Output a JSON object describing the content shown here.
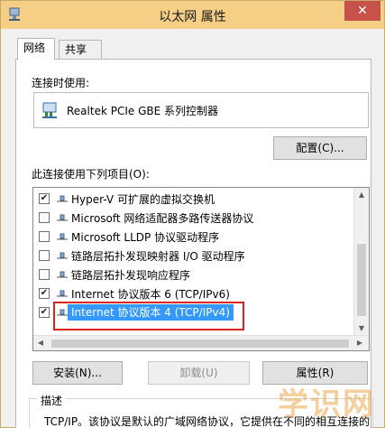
{
  "window": {
    "title": "以太网 属性",
    "close_glyph": "✕"
  },
  "tabs": [
    {
      "label": "网络",
      "active": true
    },
    {
      "label": "共享",
      "active": false
    }
  ],
  "connect_using": {
    "label": "连接时使用:",
    "adapter_name": "Realtek PCIe GBE 系列控制器",
    "configure_button": "配置(C)..."
  },
  "items_section": {
    "label": "此连接使用下列项目(O):",
    "items": [
      {
        "label": "Hyper-V 可扩展的虚拟交换机",
        "checked": true,
        "selected": false
      },
      {
        "label": "Microsoft 网络适配器多路传送器协议",
        "checked": false,
        "selected": false
      },
      {
        "label": "Microsoft LLDP 协议驱动程序",
        "checked": false,
        "selected": false
      },
      {
        "label": "链路层拓扑发现映射器 I/O 驱动程序",
        "checked": false,
        "selected": false
      },
      {
        "label": "链路层拓扑发现响应程序",
        "checked": false,
        "selected": false
      },
      {
        "label": "Internet 协议版本 6 (TCP/IPv6)",
        "checked": true,
        "selected": false
      },
      {
        "label": "Internet 协议版本 4 (TCP/IPv4)",
        "checked": true,
        "selected": true
      }
    ],
    "check_glyph": "✔"
  },
  "buttons": {
    "install": "安装(N)...",
    "uninstall": "卸载(U)",
    "properties": "属性(R)"
  },
  "description": {
    "title": "描述",
    "text": "TCP/IP。该协议是默认的广域网络协议，它提供在不同的相互连接的"
  },
  "watermark": "学识网",
  "colors": {
    "titlebar": "#f6cf86",
    "selection": "#3399ff",
    "highlight_box": "#d9241b"
  }
}
